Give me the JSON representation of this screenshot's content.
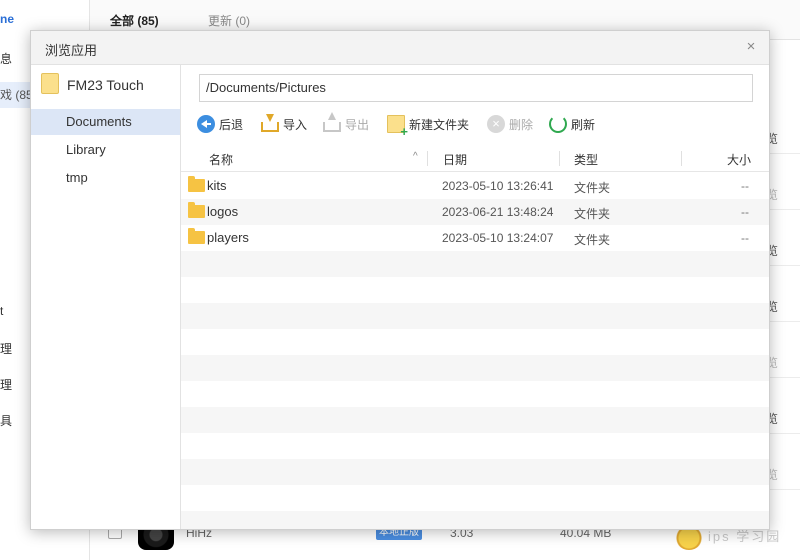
{
  "background": {
    "sidebar": {
      "brand_fragment": "ne",
      "item_fragment_1": "息",
      "active_fragment": "戏 (85",
      "fragments": [
        "t",
        "理",
        "理",
        "具"
      ]
    },
    "tabs": [
      {
        "label": "全部 (85)"
      },
      {
        "label": "更新 (0)"
      }
    ],
    "row_button_label": "览",
    "bottom_row": {
      "name": "HiHz",
      "badge": "本地正版",
      "version": "3.03",
      "size": "40.04 MB"
    },
    "watermark": "ips 学习园"
  },
  "dialog": {
    "title": "浏览应用",
    "close_label": "×",
    "root_label": "FM23 Touch",
    "tree": [
      {
        "label": "Documents",
        "selected": true
      },
      {
        "label": "Library",
        "selected": false
      },
      {
        "label": "tmp",
        "selected": false
      }
    ],
    "path": "/Documents/Pictures",
    "toolbar": {
      "back": "后退",
      "import": "导入",
      "export": "导出",
      "new_folder": "新建文件夹",
      "delete": "删除",
      "refresh": "刷新"
    },
    "columns": {
      "name": "名称",
      "date": "日期",
      "type": "类型",
      "size": "大小",
      "sort_indicator": "^"
    },
    "files": [
      {
        "name": "kits",
        "date": "2023-05-10 13:26:41",
        "type": "文件夹",
        "size": "--"
      },
      {
        "name": "logos",
        "date": "2023-06-21 13:48:24",
        "type": "文件夹",
        "size": "--"
      },
      {
        "name": "players",
        "date": "2023-05-10 13:24:07",
        "type": "文件夹",
        "size": "--"
      }
    ]
  }
}
